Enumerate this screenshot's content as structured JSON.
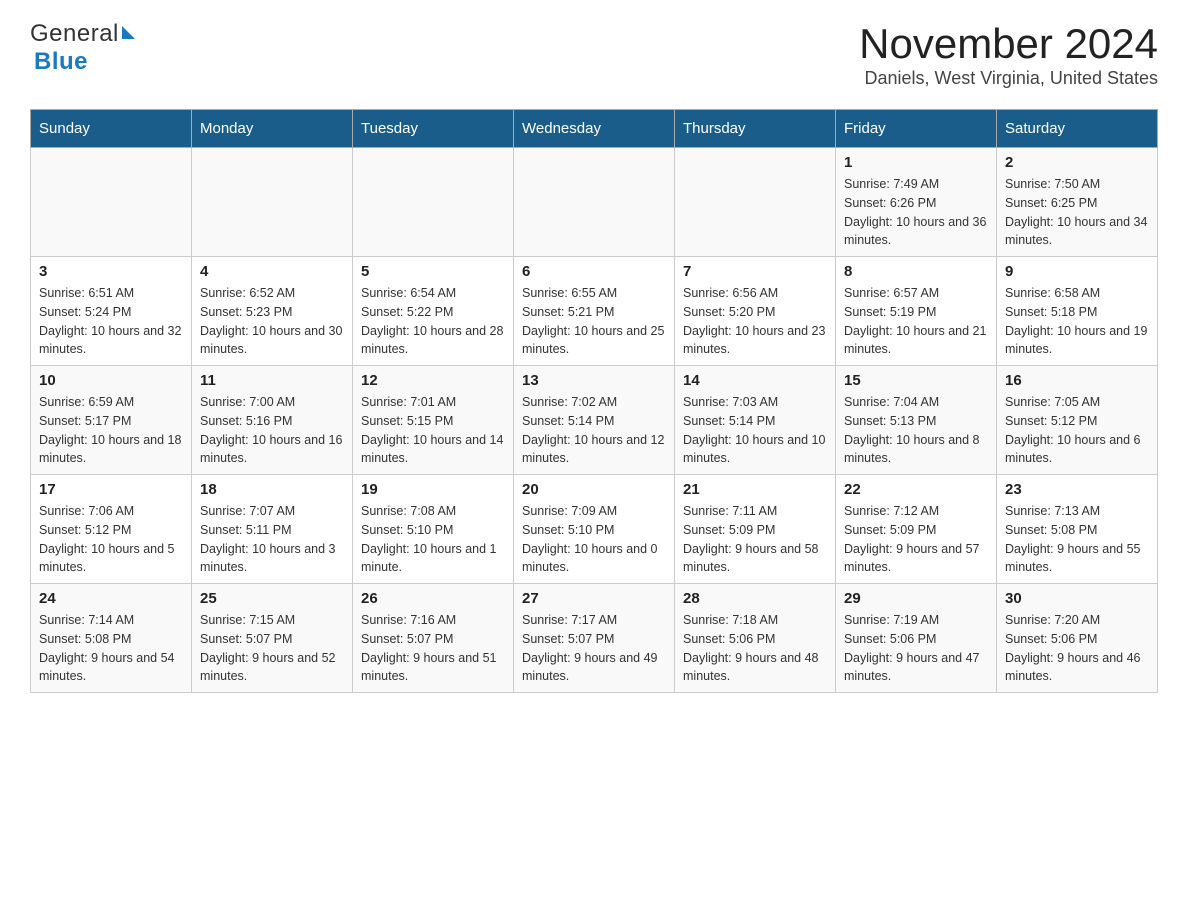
{
  "header": {
    "logo_general": "General",
    "logo_blue": "Blue",
    "title": "November 2024",
    "subtitle": "Daniels, West Virginia, United States"
  },
  "weekdays": [
    "Sunday",
    "Monday",
    "Tuesday",
    "Wednesday",
    "Thursday",
    "Friday",
    "Saturday"
  ],
  "weeks": [
    [
      {
        "day": "",
        "info": ""
      },
      {
        "day": "",
        "info": ""
      },
      {
        "day": "",
        "info": ""
      },
      {
        "day": "",
        "info": ""
      },
      {
        "day": "",
        "info": ""
      },
      {
        "day": "1",
        "info": "Sunrise: 7:49 AM\nSunset: 6:26 PM\nDaylight: 10 hours and 36 minutes."
      },
      {
        "day": "2",
        "info": "Sunrise: 7:50 AM\nSunset: 6:25 PM\nDaylight: 10 hours and 34 minutes."
      }
    ],
    [
      {
        "day": "3",
        "info": "Sunrise: 6:51 AM\nSunset: 5:24 PM\nDaylight: 10 hours and 32 minutes."
      },
      {
        "day": "4",
        "info": "Sunrise: 6:52 AM\nSunset: 5:23 PM\nDaylight: 10 hours and 30 minutes."
      },
      {
        "day": "5",
        "info": "Sunrise: 6:54 AM\nSunset: 5:22 PM\nDaylight: 10 hours and 28 minutes."
      },
      {
        "day": "6",
        "info": "Sunrise: 6:55 AM\nSunset: 5:21 PM\nDaylight: 10 hours and 25 minutes."
      },
      {
        "day": "7",
        "info": "Sunrise: 6:56 AM\nSunset: 5:20 PM\nDaylight: 10 hours and 23 minutes."
      },
      {
        "day": "8",
        "info": "Sunrise: 6:57 AM\nSunset: 5:19 PM\nDaylight: 10 hours and 21 minutes."
      },
      {
        "day": "9",
        "info": "Sunrise: 6:58 AM\nSunset: 5:18 PM\nDaylight: 10 hours and 19 minutes."
      }
    ],
    [
      {
        "day": "10",
        "info": "Sunrise: 6:59 AM\nSunset: 5:17 PM\nDaylight: 10 hours and 18 minutes."
      },
      {
        "day": "11",
        "info": "Sunrise: 7:00 AM\nSunset: 5:16 PM\nDaylight: 10 hours and 16 minutes."
      },
      {
        "day": "12",
        "info": "Sunrise: 7:01 AM\nSunset: 5:15 PM\nDaylight: 10 hours and 14 minutes."
      },
      {
        "day": "13",
        "info": "Sunrise: 7:02 AM\nSunset: 5:14 PM\nDaylight: 10 hours and 12 minutes."
      },
      {
        "day": "14",
        "info": "Sunrise: 7:03 AM\nSunset: 5:14 PM\nDaylight: 10 hours and 10 minutes."
      },
      {
        "day": "15",
        "info": "Sunrise: 7:04 AM\nSunset: 5:13 PM\nDaylight: 10 hours and 8 minutes."
      },
      {
        "day": "16",
        "info": "Sunrise: 7:05 AM\nSunset: 5:12 PM\nDaylight: 10 hours and 6 minutes."
      }
    ],
    [
      {
        "day": "17",
        "info": "Sunrise: 7:06 AM\nSunset: 5:12 PM\nDaylight: 10 hours and 5 minutes."
      },
      {
        "day": "18",
        "info": "Sunrise: 7:07 AM\nSunset: 5:11 PM\nDaylight: 10 hours and 3 minutes."
      },
      {
        "day": "19",
        "info": "Sunrise: 7:08 AM\nSunset: 5:10 PM\nDaylight: 10 hours and 1 minute."
      },
      {
        "day": "20",
        "info": "Sunrise: 7:09 AM\nSunset: 5:10 PM\nDaylight: 10 hours and 0 minutes."
      },
      {
        "day": "21",
        "info": "Sunrise: 7:11 AM\nSunset: 5:09 PM\nDaylight: 9 hours and 58 minutes."
      },
      {
        "day": "22",
        "info": "Sunrise: 7:12 AM\nSunset: 5:09 PM\nDaylight: 9 hours and 57 minutes."
      },
      {
        "day": "23",
        "info": "Sunrise: 7:13 AM\nSunset: 5:08 PM\nDaylight: 9 hours and 55 minutes."
      }
    ],
    [
      {
        "day": "24",
        "info": "Sunrise: 7:14 AM\nSunset: 5:08 PM\nDaylight: 9 hours and 54 minutes."
      },
      {
        "day": "25",
        "info": "Sunrise: 7:15 AM\nSunset: 5:07 PM\nDaylight: 9 hours and 52 minutes."
      },
      {
        "day": "26",
        "info": "Sunrise: 7:16 AM\nSunset: 5:07 PM\nDaylight: 9 hours and 51 minutes."
      },
      {
        "day": "27",
        "info": "Sunrise: 7:17 AM\nSunset: 5:07 PM\nDaylight: 9 hours and 49 minutes."
      },
      {
        "day": "28",
        "info": "Sunrise: 7:18 AM\nSunset: 5:06 PM\nDaylight: 9 hours and 48 minutes."
      },
      {
        "day": "29",
        "info": "Sunrise: 7:19 AM\nSunset: 5:06 PM\nDaylight: 9 hours and 47 minutes."
      },
      {
        "day": "30",
        "info": "Sunrise: 7:20 AM\nSunset: 5:06 PM\nDaylight: 9 hours and 46 minutes."
      }
    ]
  ]
}
